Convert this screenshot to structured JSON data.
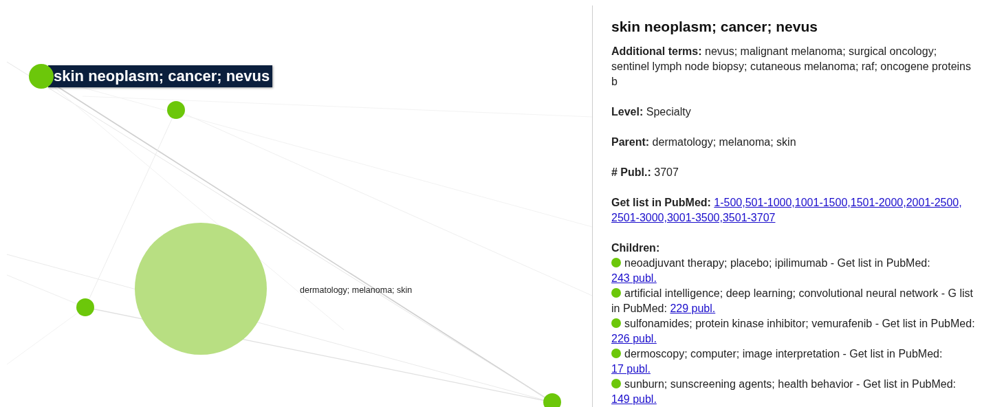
{
  "graph": {
    "nodes": [
      {
        "kind": "focus",
        "label": "skin neoplasm; cancer; nevus"
      },
      {
        "kind": "small"
      },
      {
        "kind": "small"
      },
      {
        "kind": "parent",
        "label": "dermatology; melanoma; skin"
      },
      {
        "kind": "small"
      }
    ]
  },
  "details": {
    "title": "skin neoplasm; cancer; nevus",
    "fields": [
      {
        "label": "Additional terms:",
        "value": "nevus; malignant melanoma; surgical oncology; sentinel lymph node biopsy; cutaneous melanoma; raf; oncogene proteins b"
      },
      {
        "label": "Level:",
        "value": "Specialty"
      },
      {
        "label": "Parent:",
        "value": "dermatology; melanoma; skin"
      },
      {
        "label": "# Publ.:",
        "value": "3707"
      }
    ],
    "pubmed": {
      "label": "Get list in PubMed:",
      "links": [
        "1-500,",
        "501-1000,",
        "1001-1500,",
        "1501-2000,",
        "2001-2500,",
        "2501-3000,",
        "3001-3500,",
        "3501-3707"
      ]
    },
    "children": {
      "label": "Children:",
      "items": [
        {
          "text": "neoadjuvant therapy; placebo; ipilimumab - Get list in PubMed:",
          "link": "243 publ.",
          "color": "#6cc70a"
        },
        {
          "text": "artificial intelligence; deep learning; convolutional neural network - G list in PubMed:",
          "link": "229 publ.",
          "color": "#6cc70a"
        },
        {
          "text": "sulfonamides; protein kinase inhibitor; vemurafenib - Get list in PubMed:",
          "link": "226 publ.",
          "color": "#6cc70a"
        },
        {
          "text": "dermoscopy; computer; image interpretation - Get list in PubMed:",
          "link": "17 publ.",
          "color": "#6cc70a"
        },
        {
          "text": "sunburn; sunscreening agents; health behavior - Get list in PubMed:",
          "link": "149 publ.",
          "color": "#6cc70a"
        }
      ]
    }
  }
}
